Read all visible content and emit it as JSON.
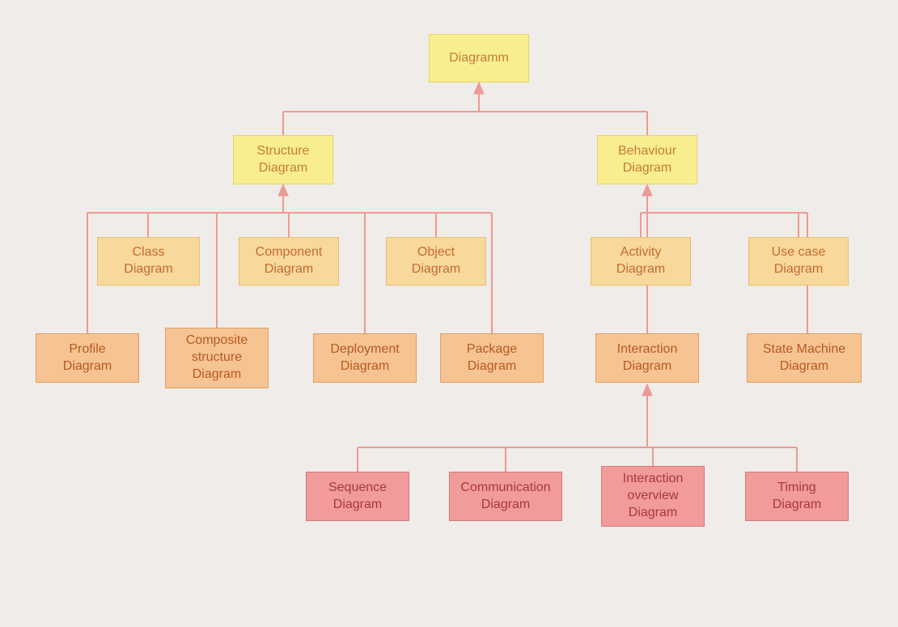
{
  "tree": {
    "root": {
      "label": "Diagramm"
    },
    "structure": {
      "label": "Structure\nDiagram"
    },
    "behaviour": {
      "label": "Behaviour\nDiagram"
    },
    "class": {
      "label": "Class\nDiagram"
    },
    "component": {
      "label": "Component\nDiagram"
    },
    "object": {
      "label": "Object\nDiagram"
    },
    "activity": {
      "label": "Activity\nDiagram"
    },
    "usecase": {
      "label": "Use case\nDiagram"
    },
    "profile": {
      "label": "Profile\nDiagram"
    },
    "composite": {
      "label": "Composite\nstructure\nDiagram"
    },
    "deployment": {
      "label": "Deployment\nDiagram"
    },
    "package": {
      "label": "Package\nDiagram"
    },
    "interaction": {
      "label": "Interaction\nDiagram"
    },
    "statemachine": {
      "label": "State Machine\nDiagram"
    },
    "sequence": {
      "label": "Sequence\nDiagram"
    },
    "communication": {
      "label": "Communication\nDiagram"
    },
    "intoverview": {
      "label": "Interaction\noverview\nDiagram"
    },
    "timing": {
      "label": "Timing\nDiagram"
    }
  },
  "colors": {
    "connector": "#ec9a93",
    "bg": "#efece9"
  }
}
